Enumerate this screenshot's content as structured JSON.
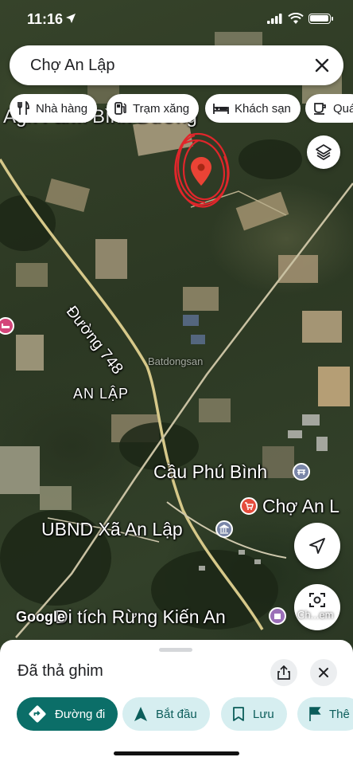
{
  "status_bar": {
    "time": "11:16"
  },
  "search": {
    "query": "Chợ An Lập"
  },
  "chips": [
    {
      "label": "Nhà hàng",
      "icon": "restaurant-icon"
    },
    {
      "label": "Trạm xăng",
      "icon": "gas-station-icon"
    },
    {
      "label": "Khách sạn",
      "icon": "hotel-icon"
    },
    {
      "label": "Quá",
      "icon": "cafe-icon"
    }
  ],
  "map": {
    "labels": {
      "farm": "Agri Farm Bình Dương",
      "road": "Đường 748",
      "commune": "AN LẬP",
      "bridge": "Cầu Phú Bình",
      "market": "Chợ An L",
      "committee": "UBND Xã An Lập",
      "relic": "Di tích Rừng Kiến An",
      "attribution": "Google",
      "watermark": "Batdongsan"
    },
    "pin_color": "#ea4335",
    "marker_annotation_color": "#e0262b",
    "lens_label": "Ch...em"
  },
  "sheet": {
    "title": "Đã thả ghim",
    "actions": [
      {
        "label": "Đường đi",
        "style": "primary",
        "icon": "directions-icon"
      },
      {
        "label": "Bắt đầu",
        "style": "secondary",
        "icon": "navigation-arrow-icon"
      },
      {
        "label": "Lưu",
        "style": "secondary",
        "icon": "bookmark-icon"
      },
      {
        "label": "Thê",
        "style": "secondary",
        "icon": "flag-icon"
      }
    ]
  },
  "colors": {
    "primary": "#0b6e68",
    "secondary_bg": "#d6eef0"
  }
}
